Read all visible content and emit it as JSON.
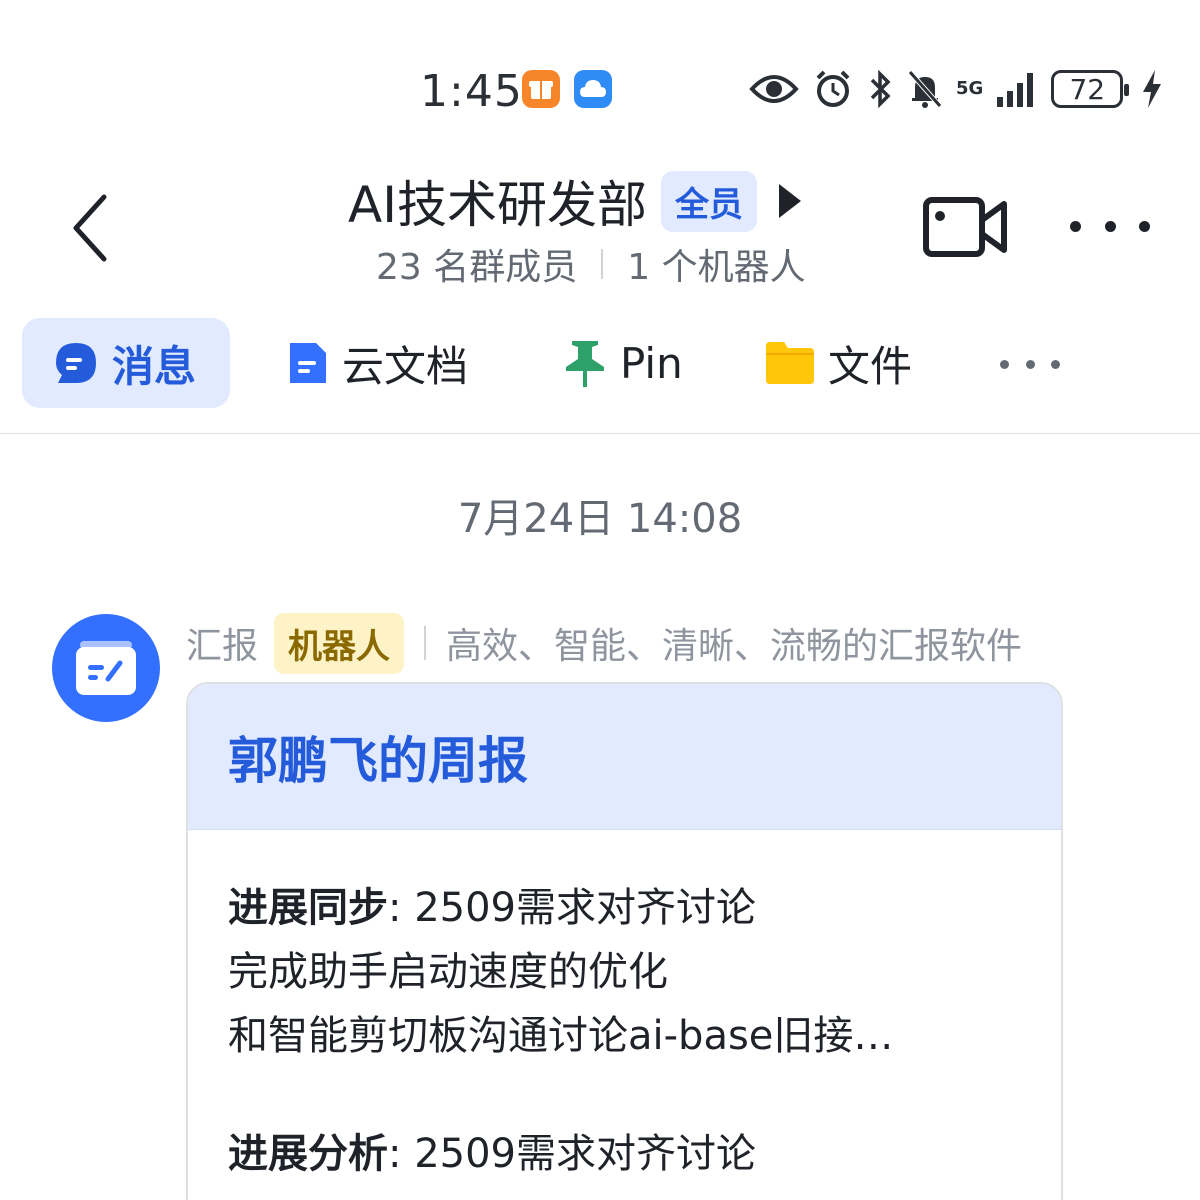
{
  "status_bar": {
    "time": "1:45",
    "network": "5G",
    "battery": "72"
  },
  "header": {
    "back_icon": "chevron-left-icon",
    "group_name": "AI技术研发部",
    "all_badge": "全员",
    "members": "23 名群成员",
    "bots": "1 个机器人",
    "video_icon": "video-camera-icon",
    "more_icon": "more-horizontal-icon"
  },
  "tabs": [
    {
      "label": "消息",
      "icon": "chat-bubble-icon",
      "active": true
    },
    {
      "label": "云文档",
      "icon": "document-icon"
    },
    {
      "label": "Pin",
      "icon": "pin-icon"
    },
    {
      "label": "文件",
      "icon": "folder-icon"
    }
  ],
  "chat": {
    "date": "7月24日 14:08",
    "message": {
      "sender": "汇报",
      "sender_badge": "机器人",
      "sender_desc": "高效、智能、清晰、流畅的汇报软件",
      "card": {
        "title": "郭鹏飞的周报",
        "sections": [
          {
            "key": "进展同步",
            "first": ": 2509需求对齐讨论",
            "line2": "完成助手启动速度的优化",
            "line3": "和智能剪切板沟通讨论ai-base旧接…"
          },
          {
            "key": "进展分析",
            "first": ": 2509需求对齐讨论"
          }
        ]
      }
    }
  },
  "colors": {
    "accent": "#245bdb",
    "accent_bg": "#e1eaff",
    "bot_badge_bg": "#fdf3c7",
    "bot_badge_text": "#8a6a00"
  }
}
